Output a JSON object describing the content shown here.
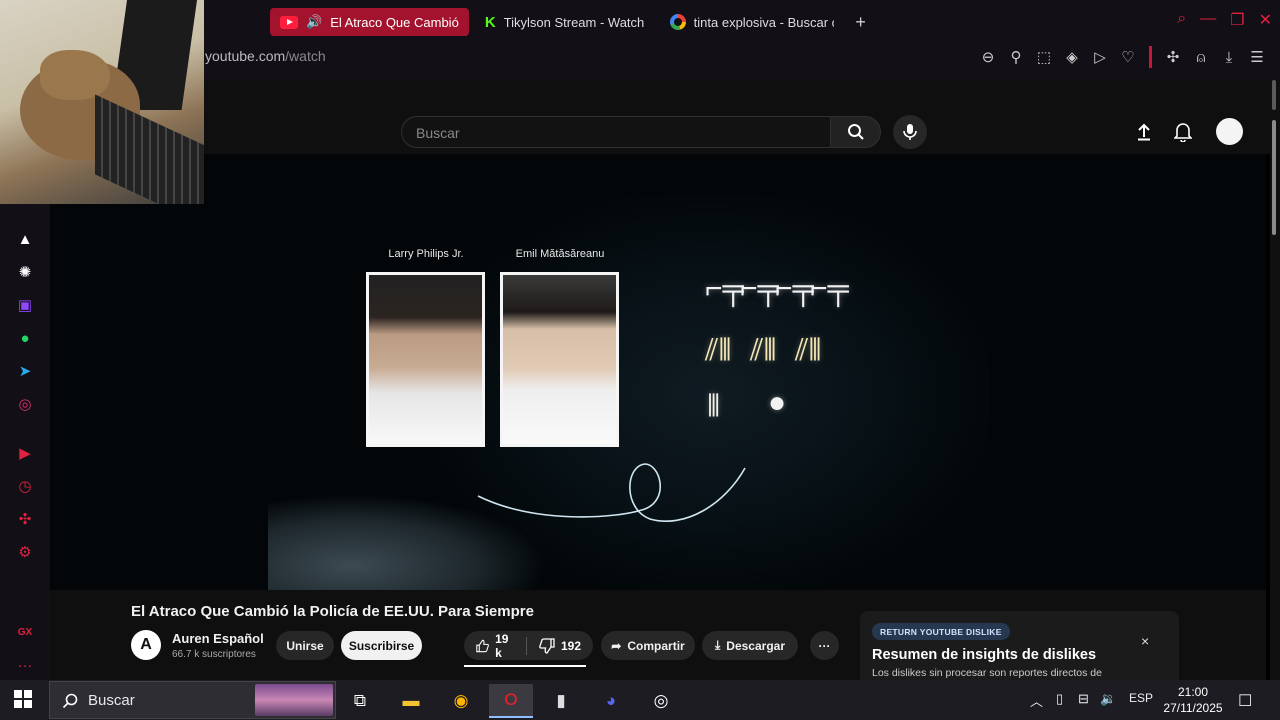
{
  "browser": {
    "tabs": [
      {
        "title": "El Atraco Que Cambió",
        "active": true,
        "icon": "youtube-icon"
      },
      {
        "title": "Tikylson Stream - Watch",
        "active": false,
        "icon": "kick-icon"
      },
      {
        "title": "tinta explosiva - Buscar c",
        "active": false,
        "icon": "google-icon"
      }
    ],
    "new_tab": "+",
    "url_host": "youtube.com",
    "url_path": "/watch",
    "accent": "#e0203f"
  },
  "youtube": {
    "search_placeholder": "Buscar",
    "video": {
      "person1": "Larry Philips Jr.",
      "person2": "Emil Mătăsăreanu"
    },
    "title": "El Atraco Que Cambió la Policía de EE.UU. Para Siempre",
    "channel": {
      "name": "Auren Español",
      "subscribers": "66.7 k suscriptores",
      "avatar_letter": "A"
    },
    "buttons": {
      "join": "Unirse",
      "subscribe": "Suscribirse",
      "likes": "19 k",
      "dislikes": "192",
      "share": "Compartir",
      "download": "Descargar",
      "more": "···"
    },
    "ryd": {
      "badge": "RETURN YOUTUBE DISLIKE",
      "title": "Resumen de insights de dislikes",
      "text": "Los dislikes sin procesar son reportes directos de",
      "close": "×"
    }
  },
  "taskbar": {
    "search": "Buscar",
    "lang": "ESP",
    "time": "21:00",
    "date": "27/11/2025"
  },
  "sidebar_gx": "GX",
  "sidebar_more": "···"
}
